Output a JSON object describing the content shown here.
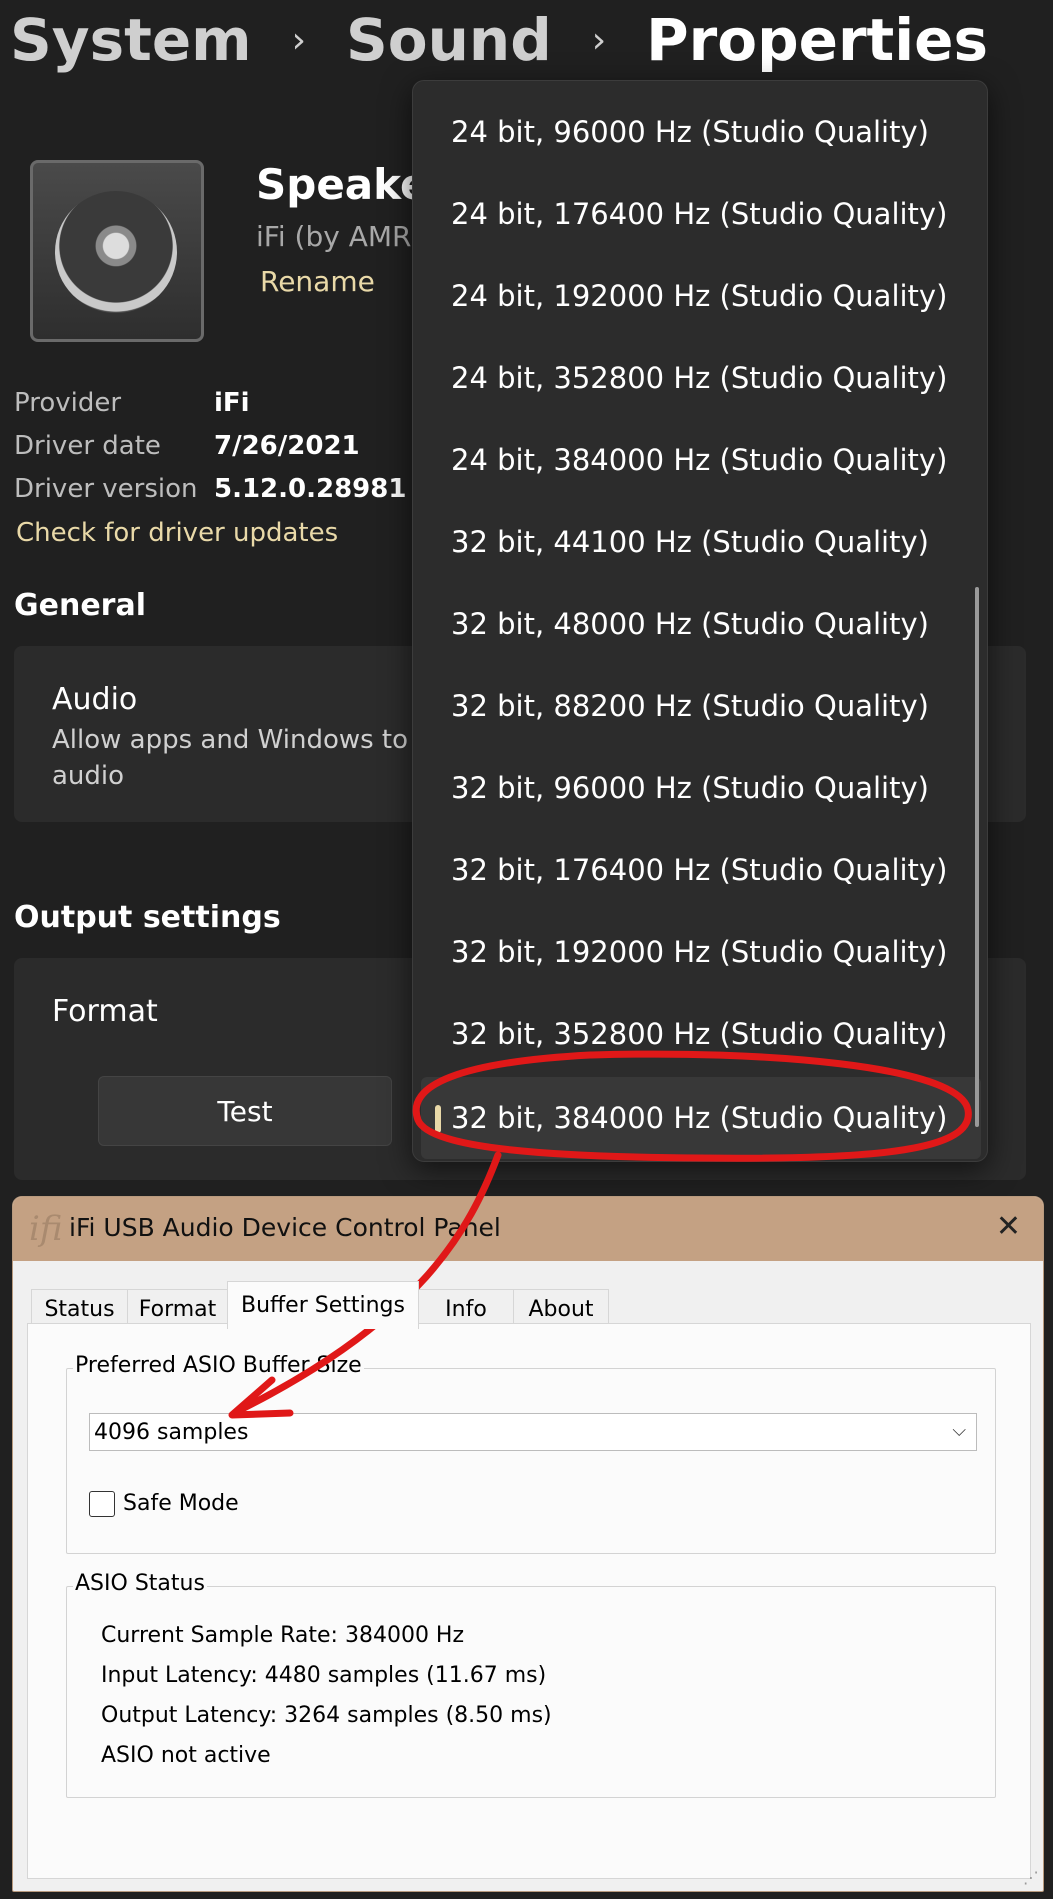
{
  "breadcrumb": {
    "item1": "System",
    "item2": "Sound",
    "current": "Properties",
    "separator": "›"
  },
  "device": {
    "name": "Speakers",
    "manufacturer": "iFi (by AMR)",
    "rename_label": "Rename"
  },
  "properties": [
    {
      "label": "Provider",
      "value": "iFi"
    },
    {
      "label": "Driver date",
      "value": "7/26/2021"
    },
    {
      "label": "Driver version",
      "value": "5.12.0.28981"
    }
  ],
  "check_updates_label": "Check for driver updates",
  "general": {
    "title": "General",
    "audio_title": "Audio",
    "audio_desc_line1": "Allow apps and Windows to u",
    "audio_desc_line2": "audio"
  },
  "output": {
    "title": "Output settings",
    "format_label": "Format",
    "test_label": "Test"
  },
  "dropdown": {
    "items": [
      "24 bit, 96000 Hz (Studio Quality)",
      "24 bit, 176400 Hz (Studio Quality)",
      "24 bit, 192000 Hz (Studio Quality)",
      "24 bit, 352800 Hz (Studio Quality)",
      "24 bit, 384000 Hz (Studio Quality)",
      "32 bit, 44100 Hz (Studio Quality)",
      "32 bit, 48000 Hz (Studio Quality)",
      "32 bit, 88200 Hz (Studio Quality)",
      "32 bit, 96000 Hz (Studio Quality)",
      "32 bit, 176400 Hz (Studio Quality)",
      "32 bit, 192000 Hz (Studio Quality)",
      "32 bit, 352800 Hz (Studio Quality)",
      "32 bit, 384000 Hz (Studio Quality)"
    ],
    "selected_index": 12
  },
  "control_panel": {
    "logo": "ifi",
    "title": "iFi USB Audio Device Control Panel",
    "close": "✕",
    "tabs": [
      "Status",
      "Format",
      "Buffer Settings",
      "Info",
      "About"
    ],
    "active_tab": "Buffer Settings",
    "buffer_group_label": "Preferred ASIO Buffer Size",
    "buffer_value": "4096 samples",
    "safe_mode_label": "Safe Mode",
    "safe_mode_checked": false,
    "asio_group_label": "ASIO Status",
    "asio_lines": [
      "Current Sample Rate: 384000 Hz",
      "Input Latency: 4480 samples (11.67 ms)",
      "Output Latency: 3264 samples (8.50 ms)",
      "ASIO not active"
    ]
  },
  "colors": {
    "background": "#202020",
    "card": "#2b2b2b",
    "accent_link": "#e9d9a8",
    "annotation": "#e01818",
    "titlebar": "#c4a183"
  }
}
